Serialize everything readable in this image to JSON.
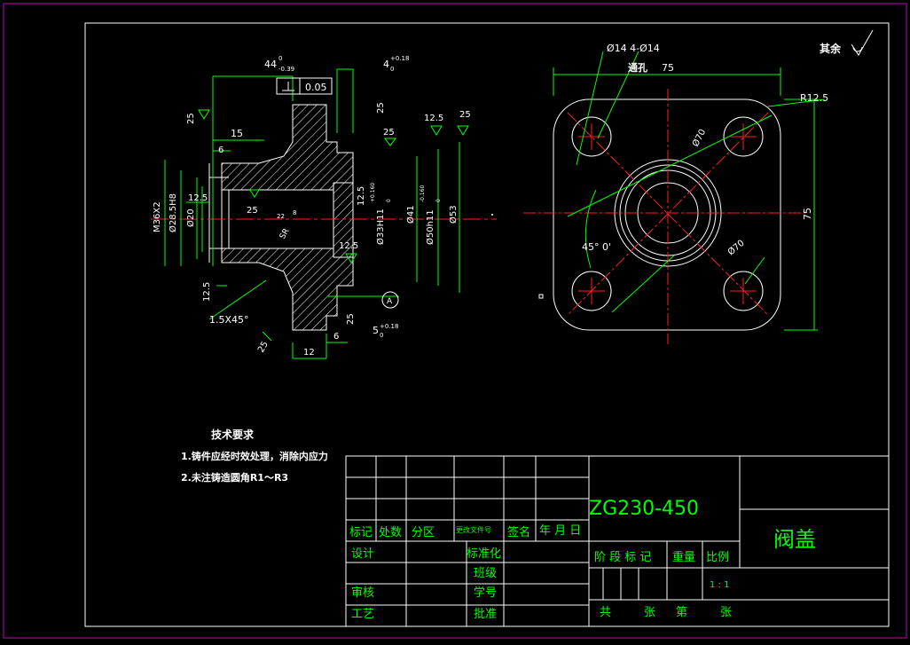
{
  "colors": {
    "background": "#000000",
    "dimension": "#00ff00",
    "outline": "#ffffff",
    "centerline": "#ff2020",
    "sheet_border": "#c000c0"
  },
  "roughness": {
    "rest_label": "其余"
  },
  "section_view": {
    "dims": {
      "len_44": "44",
      "tol_44": "0",
      "tol_44b": "-0.39",
      "len_4": "4",
      "tol_4a": "+0.18",
      "tol_4b": "0",
      "perp_val": "0.05",
      "datum_a": "A",
      "d15": "15",
      "d6": "6",
      "m36": "M36X2",
      "d28": "Ø28.5H8",
      "d20": "Ø20",
      "d33": "Ø33H11",
      "tol33a": "+0.160",
      "tol33b": "0",
      "d41": "Ø41",
      "d50": "Ø50h11",
      "tol50a": "-0.160",
      "tol50b": "0",
      "d53": "Ø53",
      "r25a": "25",
      "r25b": "25",
      "r25c": "25",
      "r25d": "25",
      "r25e": "25",
      "r25f": "25",
      "r25g": "25",
      "r125a": "12.5",
      "r125b": "12.5",
      "r125c": "12.5",
      "r125d": "12.5",
      "r125e": "12.5",
      "chamfer": "1.5X45°",
      "d12": "12",
      "d6b": "6",
      "d5": "5",
      "tol5a": "+0.18",
      "tol5b": "0",
      "sr": "SR",
      "r8": "8",
      "r22": "22"
    }
  },
  "plan_view": {
    "hole_note": "Ø14 4-Ø14",
    "thru_note": "通孔",
    "width": "75",
    "height": "75",
    "corner_r": "R12.5",
    "pcd_a": "Ø70",
    "pcd_b": "Ø70",
    "angle": "45° 0'"
  },
  "tech_notes": {
    "title": "技术要求",
    "items": [
      "1.铸件应经时效处理，消除内应力",
      "2.未注铸造圆角R1～R3"
    ]
  },
  "title_block": {
    "material": "ZG230-450",
    "part_name": "阀盖",
    "rev_headers": [
      "标记",
      "处数",
      "分区",
      "更改文件号",
      "签名",
      "年 月 日"
    ],
    "rows": {
      "design": "设计",
      "std": "标准化",
      "class": "班级",
      "review": "审核",
      "student_no": "学号",
      "process": "工艺",
      "approve": "批准"
    },
    "stage_headers": {
      "stage": "阶 段 标 记",
      "weight": "重量",
      "scale_label": "比例"
    },
    "scale": "1 : 1",
    "sheets": {
      "total": "共",
      "sheet": "张",
      "no": "第",
      "sheet2": "张"
    }
  }
}
